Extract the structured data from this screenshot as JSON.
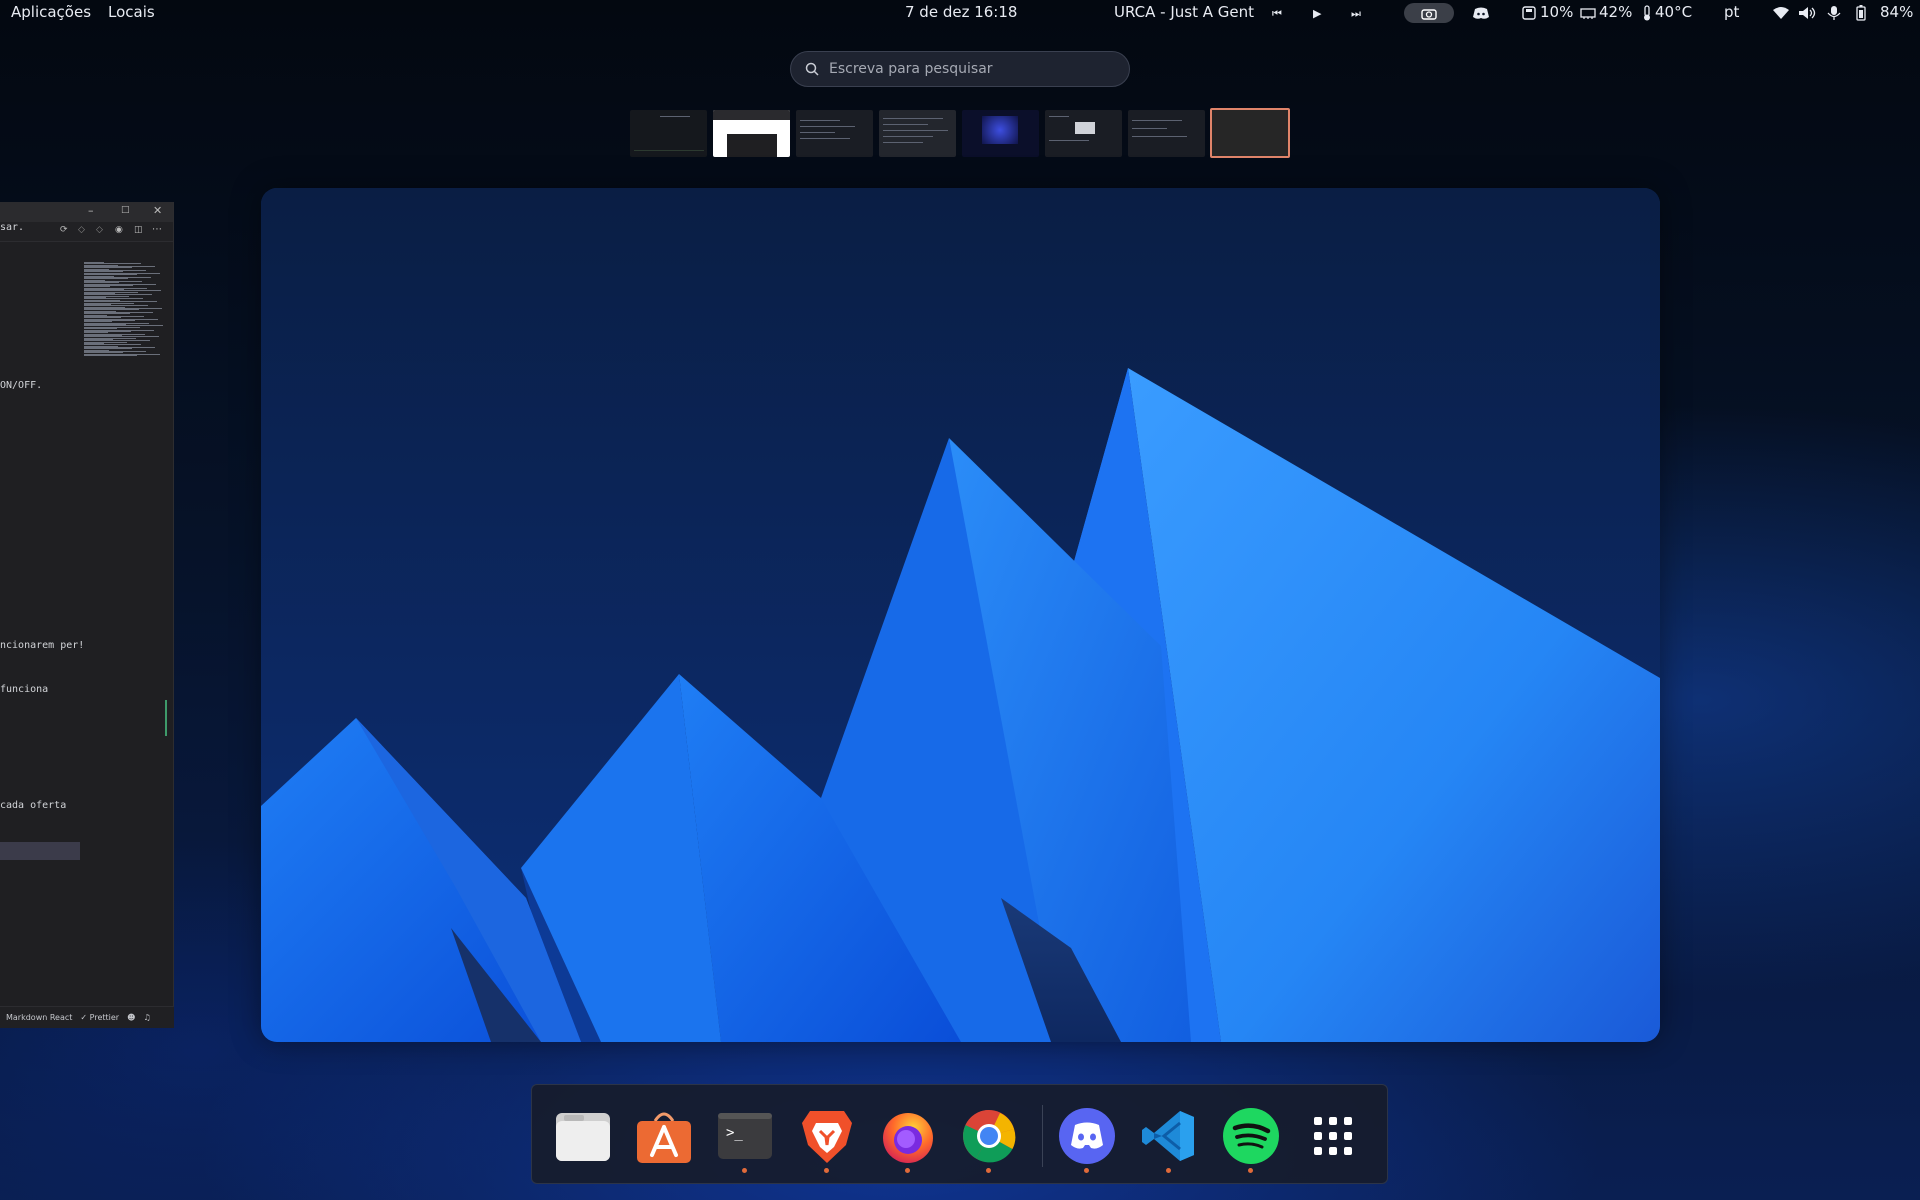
{
  "topbar": {
    "apps": "Aplicações",
    "places": "Locais",
    "clock": "7 de dez 16:18",
    "media_title": "URCA - Just A Gent",
    "disk": "10%",
    "memory": "42%",
    "temp": "40°C",
    "lang": "pt",
    "battery": "84%"
  },
  "search": {
    "placeholder": "Escreva para pesquisar"
  },
  "editor": {
    "lines": [
      "sar.",
      "ON/OFF.",
      "ncionarem per!",
      " funciona",
      "cada oferta"
    ],
    "status_left": "Markdown React",
    "status_prettier": "Prettier"
  },
  "dock": {
    "items": [
      {
        "name": "Files",
        "icon": "folder-icon",
        "running": false
      },
      {
        "name": "App Center",
        "icon": "store-icon",
        "running": false
      },
      {
        "name": "Terminal",
        "icon": "terminal-icon",
        "running": true
      },
      {
        "name": "Brave",
        "icon": "brave-icon",
        "running": true
      },
      {
        "name": "Firefox",
        "icon": "firefox-icon",
        "running": true
      },
      {
        "name": "Chrome",
        "icon": "chrome-icon",
        "running": true
      },
      {
        "name": "Discord",
        "icon": "discord-icon",
        "running": true
      },
      {
        "name": "VS Code",
        "icon": "vscode-icon",
        "running": true
      },
      {
        "name": "Spotify",
        "icon": "spotify-icon",
        "running": true
      },
      {
        "name": "Show Apps",
        "icon": "app-grid-icon",
        "running": false
      }
    ]
  },
  "colors": {
    "accent": "#e0846a",
    "running_dot": "#e06a3a"
  }
}
